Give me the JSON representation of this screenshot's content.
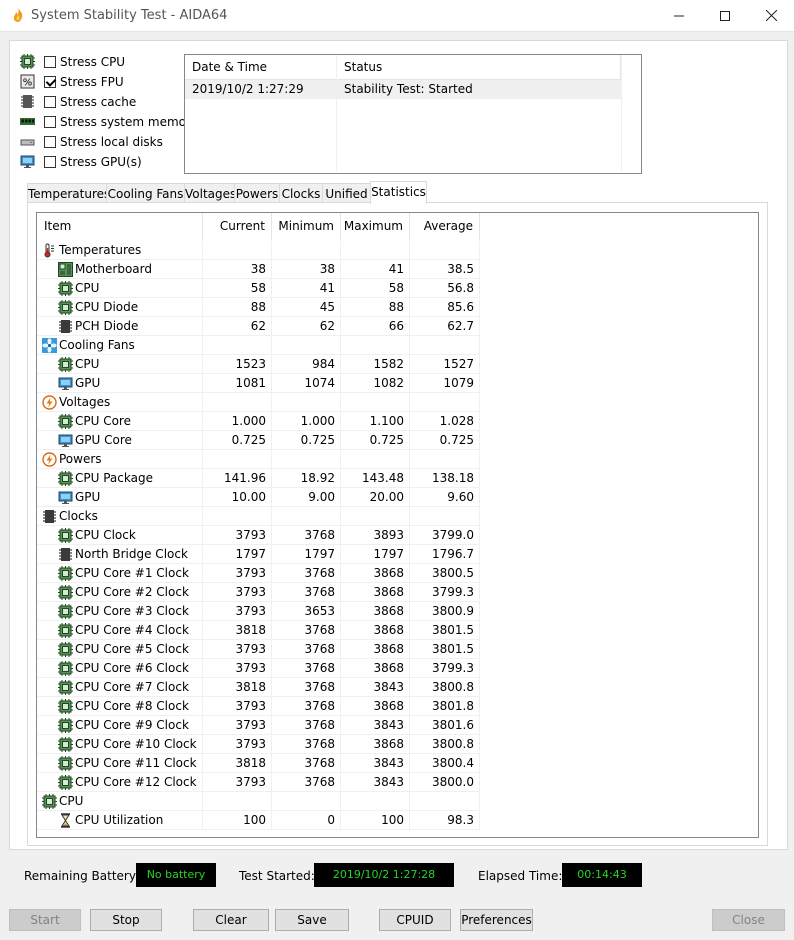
{
  "window": {
    "title": "System Stability Test - AIDA64"
  },
  "stress": [
    {
      "label": "Stress CPU",
      "checked": false,
      "icon": "cpu-chip-icon"
    },
    {
      "label": "Stress FPU",
      "checked": true,
      "icon": "fpu-percent-icon"
    },
    {
      "label": "Stress cache",
      "checked": false,
      "icon": "cache-chip-icon"
    },
    {
      "label": "Stress system memory",
      "checked": false,
      "icon": "memory-stick-icon"
    },
    {
      "label": "Stress local disks",
      "checked": false,
      "icon": "disk-drive-icon"
    },
    {
      "label": "Stress GPU(s)",
      "checked": false,
      "icon": "monitor-icon"
    }
  ],
  "status_table": {
    "headers": {
      "datetime": "Date & Time",
      "status": "Status"
    },
    "rows": [
      {
        "datetime": "2019/10/2 1:27:29",
        "status": "Stability Test: Started"
      }
    ]
  },
  "tabs": [
    "Temperatures",
    "Cooling Fans",
    "Voltages",
    "Powers",
    "Clocks",
    "Unified",
    "Statistics"
  ],
  "active_tab": "Statistics",
  "stats": {
    "headers": {
      "item": "Item",
      "current": "Current",
      "minimum": "Minimum",
      "maximum": "Maximum",
      "average": "Average"
    },
    "rows": [
      {
        "type": "group",
        "label": "Temperatures",
        "icon": "thermometer-icon"
      },
      {
        "type": "item",
        "label": "Motherboard",
        "icon": "motherboard-icon",
        "current": "38",
        "min": "38",
        "max": "41",
        "avg": "38.5"
      },
      {
        "type": "item",
        "label": "CPU",
        "icon": "cpu-chip-icon",
        "current": "58",
        "min": "41",
        "max": "58",
        "avg": "56.8"
      },
      {
        "type": "item",
        "label": "CPU Diode",
        "icon": "cpu-chip-icon",
        "current": "88",
        "min": "45",
        "max": "88",
        "avg": "85.6"
      },
      {
        "type": "item",
        "label": "PCH Diode",
        "icon": "pch-chip-icon",
        "current": "62",
        "min": "62",
        "max": "66",
        "avg": "62.7"
      },
      {
        "type": "group",
        "label": "Cooling Fans",
        "icon": "fan-icon"
      },
      {
        "type": "item",
        "label": "CPU",
        "icon": "cpu-chip-icon",
        "current": "1523",
        "min": "984",
        "max": "1582",
        "avg": "1527"
      },
      {
        "type": "item",
        "label": "GPU",
        "icon": "monitor-icon",
        "current": "1081",
        "min": "1074",
        "max": "1082",
        "avg": "1079"
      },
      {
        "type": "group",
        "label": "Voltages",
        "icon": "lightning-icon"
      },
      {
        "type": "item",
        "label": "CPU Core",
        "icon": "cpu-chip-icon",
        "current": "1.000",
        "min": "1.000",
        "max": "1.100",
        "avg": "1.028"
      },
      {
        "type": "item",
        "label": "GPU Core",
        "icon": "monitor-icon",
        "current": "0.725",
        "min": "0.725",
        "max": "0.725",
        "avg": "0.725"
      },
      {
        "type": "group",
        "label": "Powers",
        "icon": "lightning-icon"
      },
      {
        "type": "item",
        "label": "CPU Package",
        "icon": "cpu-chip-icon",
        "current": "141.96",
        "min": "18.92",
        "max": "143.48",
        "avg": "138.18"
      },
      {
        "type": "item",
        "label": "GPU",
        "icon": "monitor-icon",
        "current": "10.00",
        "min": "9.00",
        "max": "20.00",
        "avg": "9.60"
      },
      {
        "type": "group",
        "label": "Clocks",
        "icon": "clock-chip-icon"
      },
      {
        "type": "item",
        "label": "CPU Clock",
        "icon": "cpu-chip-icon",
        "current": "3793",
        "min": "3768",
        "max": "3893",
        "avg": "3799.0"
      },
      {
        "type": "item",
        "label": "North Bridge Clock",
        "icon": "pch-chip-icon",
        "current": "1797",
        "min": "1797",
        "max": "1797",
        "avg": "1796.7"
      },
      {
        "type": "item",
        "label": "CPU Core #1 Clock",
        "icon": "cpu-chip-icon",
        "current": "3793",
        "min": "3768",
        "max": "3868",
        "avg": "3800.5"
      },
      {
        "type": "item",
        "label": "CPU Core #2 Clock",
        "icon": "cpu-chip-icon",
        "current": "3793",
        "min": "3768",
        "max": "3868",
        "avg": "3799.3"
      },
      {
        "type": "item",
        "label": "CPU Core #3 Clock",
        "icon": "cpu-chip-icon",
        "current": "3793",
        "min": "3653",
        "max": "3868",
        "avg": "3800.9"
      },
      {
        "type": "item",
        "label": "CPU Core #4 Clock",
        "icon": "cpu-chip-icon",
        "current": "3818",
        "min": "3768",
        "max": "3868",
        "avg": "3801.5"
      },
      {
        "type": "item",
        "label": "CPU Core #5 Clock",
        "icon": "cpu-chip-icon",
        "current": "3793",
        "min": "3768",
        "max": "3868",
        "avg": "3801.5"
      },
      {
        "type": "item",
        "label": "CPU Core #6 Clock",
        "icon": "cpu-chip-icon",
        "current": "3793",
        "min": "3768",
        "max": "3868",
        "avg": "3799.3"
      },
      {
        "type": "item",
        "label": "CPU Core #7 Clock",
        "icon": "cpu-chip-icon",
        "current": "3818",
        "min": "3768",
        "max": "3843",
        "avg": "3800.8"
      },
      {
        "type": "item",
        "label": "CPU Core #8 Clock",
        "icon": "cpu-chip-icon",
        "current": "3793",
        "min": "3768",
        "max": "3868",
        "avg": "3801.8"
      },
      {
        "type": "item",
        "label": "CPU Core #9 Clock",
        "icon": "cpu-chip-icon",
        "current": "3793",
        "min": "3768",
        "max": "3843",
        "avg": "3801.6"
      },
      {
        "type": "item",
        "label": "CPU Core #10 Clock",
        "icon": "cpu-chip-icon",
        "current": "3793",
        "min": "3768",
        "max": "3868",
        "avg": "3800.8"
      },
      {
        "type": "item",
        "label": "CPU Core #11 Clock",
        "icon": "cpu-chip-icon",
        "current": "3818",
        "min": "3768",
        "max": "3843",
        "avg": "3800.4"
      },
      {
        "type": "item",
        "label": "CPU Core #12 Clock",
        "icon": "cpu-chip-icon",
        "current": "3793",
        "min": "3768",
        "max": "3843",
        "avg": "3800.0"
      },
      {
        "type": "group",
        "label": "CPU",
        "icon": "cpu-chip-icon"
      },
      {
        "type": "item",
        "label": "CPU Utilization",
        "icon": "hourglass-icon",
        "current": "100",
        "min": "0",
        "max": "100",
        "avg": "98.3"
      }
    ]
  },
  "footer": {
    "battery_label": "Remaining Battery:",
    "battery_value": "No battery",
    "started_label": "Test Started:",
    "started_value": "2019/10/2 1:27:28",
    "elapsed_label": "Elapsed Time:",
    "elapsed_value": "00:14:43"
  },
  "buttons": {
    "start": "Start",
    "stop": "Stop",
    "clear": "Clear",
    "save": "Save",
    "cpuid": "CPUID",
    "preferences": "Preferences",
    "close": "Close"
  },
  "colors": {
    "led_bg": "#000000",
    "led_text": "#27d427",
    "accent_icon": "#2a7fd4"
  }
}
